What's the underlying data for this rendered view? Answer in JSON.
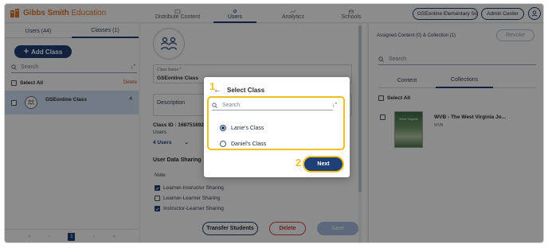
{
  "brand": {
    "name_bold": "Gibbs Smith",
    "name_light": " Education",
    "color": "#e2772a"
  },
  "nav": {
    "tabs": [
      {
        "label": "Distribute Content",
        "icon": "distribute-icon"
      },
      {
        "label": "Users",
        "icon": "users-icon",
        "active": true
      },
      {
        "label": "Analytics",
        "icon": "analytics-icon"
      },
      {
        "label": "Schools",
        "icon": "schools-icon"
      }
    ],
    "school_selector": "GSEonline Elementary Scho",
    "admin_center": "Admin Center",
    "user_icon": "user-circle-icon"
  },
  "left": {
    "tabs": {
      "users": "Users (44)",
      "classes": "Classes (1)"
    },
    "active_tab": "classes",
    "add_class": "Add Class",
    "search_placeholder": "Search",
    "select_all": "Select All",
    "delete": "Delete",
    "classes": [
      {
        "name": "GSEonline Class",
        "count": "4"
      }
    ],
    "pager": {
      "first": "«",
      "prev": "‹",
      "current": "1",
      "next": "›",
      "last": "»"
    }
  },
  "middle": {
    "class_name_label": "Class Name *",
    "class_name_value": "GSEonline Class",
    "description_label": "Description",
    "class_id": "Class ID : 16875189212",
    "users_label": "Users",
    "users_count": "4 Users",
    "user_data_sharing": "User Data Sharing",
    "note": "Note",
    "sharing": [
      {
        "label": "Learner-Instructor Sharing",
        "checked": true
      },
      {
        "label": "Learner-Learner Sharing",
        "checked": false
      },
      {
        "label": "Instructor-Learner Sharing",
        "checked": true
      }
    ],
    "buttons": {
      "transfer": "Transfer Students",
      "delete": "Delete",
      "save": "Save"
    }
  },
  "right": {
    "assigned": "Assigned Content (0) & Collection (1)",
    "revoke": "Revoke",
    "search_placeholder": "Search",
    "tabs": {
      "content": "Content",
      "collections": "Collections"
    },
    "active_tab": "collections",
    "select_all": "Select All",
    "item": {
      "title": "WVB - The West Virginia Jo...",
      "subtitle": "WVB",
      "cover_text": "West Virginia"
    }
  },
  "modal": {
    "title": "Select Class",
    "search_placeholder": "Search",
    "options": [
      {
        "label": "Lanie's Class",
        "selected": true
      },
      {
        "label": "Daniel's Class",
        "selected": false
      }
    ],
    "next": "Next",
    "steps": [
      "1",
      "2"
    ],
    "highlight_color": "#f2c01e"
  },
  "colors": {
    "primary": "#1f3f77",
    "danger": "#d24a4a",
    "selected_row": "#cfe0f5"
  }
}
